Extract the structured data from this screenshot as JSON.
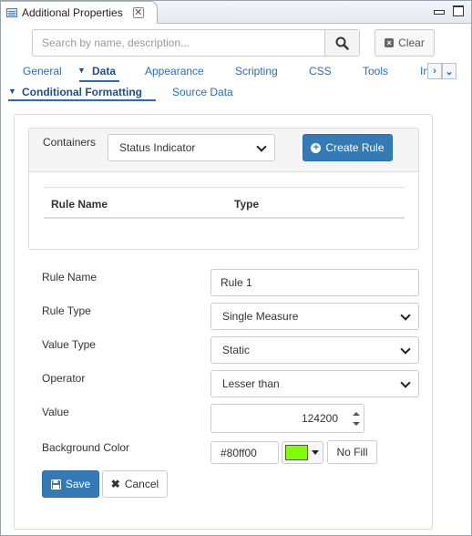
{
  "window": {
    "tab_title": "Additional Properties",
    "tab_close": "✕"
  },
  "search": {
    "placeholder": "Search by name, description...",
    "value": "",
    "clear_label": "Clear"
  },
  "tabs": [
    {
      "label": "General",
      "active": false
    },
    {
      "label": "Data",
      "active": true
    },
    {
      "label": "Appearance",
      "active": false
    },
    {
      "label": "Scripting",
      "active": false
    },
    {
      "label": "CSS",
      "active": false
    },
    {
      "label": "Tools",
      "active": false
    },
    {
      "label": "In",
      "active": false
    }
  ],
  "subtabs": [
    {
      "label": "Conditional Formatting",
      "active": true
    },
    {
      "label": "Source Data",
      "active": false
    }
  ],
  "containers": {
    "label": "Containers",
    "selected": "Status Indicator",
    "create_rule_label": "Create Rule",
    "table_headers": [
      "Rule Name",
      "Type"
    ]
  },
  "form": {
    "rule_name": {
      "label": "Rule Name",
      "value": "Rule 1"
    },
    "rule_type": {
      "label": "Rule Type",
      "value": "Single Measure"
    },
    "value_type": {
      "label": "Value Type",
      "value": "Static"
    },
    "operator": {
      "label": "Operator",
      "value": "Lesser than"
    },
    "value": {
      "label": "Value",
      "value": "124200"
    },
    "background_color": {
      "label": "Background Color",
      "hex": "#80ff00",
      "swatch_color": "#80ff00",
      "no_fill_label": "No Fill"
    }
  },
  "actions": {
    "save_label": "Save",
    "cancel_label": "Cancel"
  },
  "colors": {
    "accent": "#337ab7",
    "link": "#2a6db5"
  }
}
